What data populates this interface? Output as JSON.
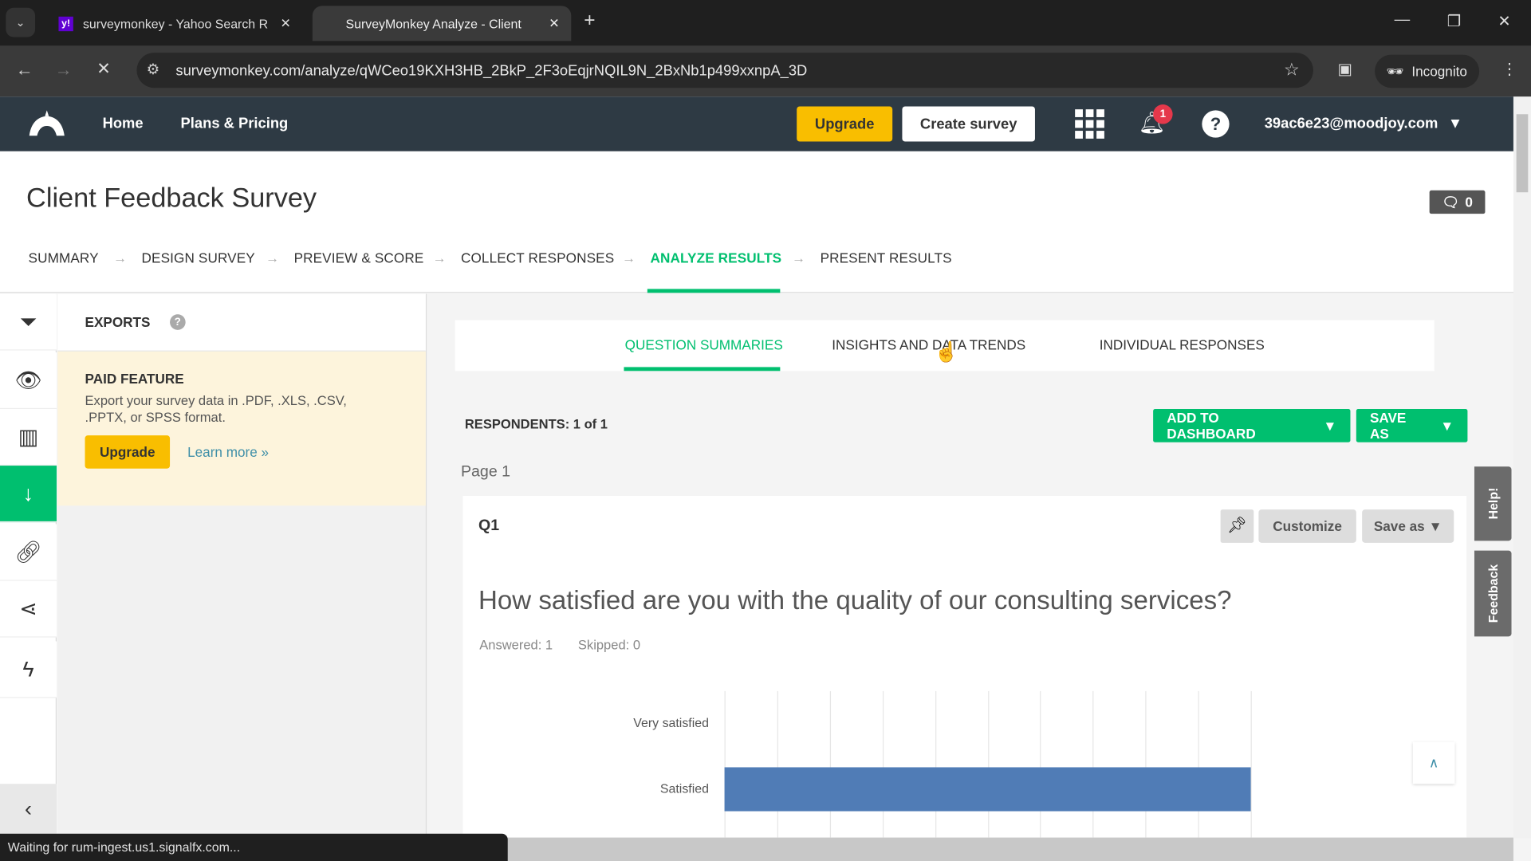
{
  "browser": {
    "tabs": [
      {
        "title": "surveymonkey - Yahoo Search R",
        "favicon": "y!"
      },
      {
        "title": "SurveyMonkey Analyze - Client",
        "active": true
      }
    ],
    "url": "surveymonkey.com/analyze/qWCeo19KXH3HB_2BkP_2F3oEqjrNQIL9N_2BxNb1p499xxnpA_3D",
    "incognito_label": "Incognito",
    "status": "Waiting for rum-ingest.us1.signalfx.com..."
  },
  "nav": {
    "home": "Home",
    "plans": "Plans & Pricing",
    "upgrade": "Upgrade",
    "create": "Create survey",
    "notifications": "1",
    "account": "39ac6e23@moodjoy.com"
  },
  "survey": {
    "title": "Client Feedback Survey",
    "comments": "0"
  },
  "steps": [
    "SUMMARY",
    "DESIGN SURVEY",
    "PREVIEW & SCORE",
    "COLLECT RESPONSES",
    "ANALYZE RESULTS",
    "PRESENT RESULTS"
  ],
  "exports": {
    "title": "EXPORTS",
    "paid": "PAID FEATURE",
    "desc": "Export your survey data in .PDF, .XLS, .CSV, .PPTX, or SPSS format.",
    "upgrade": "Upgrade",
    "learn": "Learn more »"
  },
  "subtabs": [
    "QUESTION SUMMARIES",
    "INSIGHTS AND DATA TRENDS",
    "INDIVIDUAL RESPONSES"
  ],
  "respondents": "RESPONDENTS: 1 of 1",
  "add_dashboard": "ADD TO DASHBOARD",
  "save_as_top": "SAVE AS",
  "page_label": "Page 1",
  "question": {
    "id": "Q1",
    "customize": "Customize",
    "save_as": "Save as",
    "text": "How satisfied are you with the quality of our consulting services?",
    "answered": "Answered: 1",
    "skipped": "Skipped: 0"
  },
  "side_tabs": {
    "help": "Help!",
    "feedback": "Feedback"
  },
  "chart_data": {
    "type": "bar",
    "orientation": "horizontal",
    "categories": [
      "Very satisfied",
      "Satisfied"
    ],
    "values": [
      0,
      100
    ],
    "xlim": [
      0,
      100
    ],
    "grid": true,
    "color": "#507cb6"
  }
}
